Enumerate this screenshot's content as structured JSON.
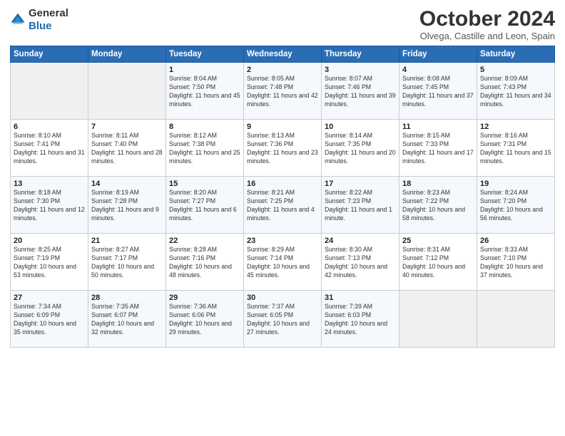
{
  "header": {
    "logo_general": "General",
    "logo_blue": "Blue",
    "title": "October 2024",
    "subtitle": "Olvega, Castille and Leon, Spain"
  },
  "weekdays": [
    "Sunday",
    "Monday",
    "Tuesday",
    "Wednesday",
    "Thursday",
    "Friday",
    "Saturday"
  ],
  "weeks": [
    [
      {
        "day": "",
        "detail": ""
      },
      {
        "day": "",
        "detail": ""
      },
      {
        "day": "1",
        "detail": "Sunrise: 8:04 AM\nSunset: 7:50 PM\nDaylight: 11 hours and 45 minutes."
      },
      {
        "day": "2",
        "detail": "Sunrise: 8:05 AM\nSunset: 7:48 PM\nDaylight: 11 hours and 42 minutes."
      },
      {
        "day": "3",
        "detail": "Sunrise: 8:07 AM\nSunset: 7:46 PM\nDaylight: 11 hours and 39 minutes."
      },
      {
        "day": "4",
        "detail": "Sunrise: 8:08 AM\nSunset: 7:45 PM\nDaylight: 11 hours and 37 minutes."
      },
      {
        "day": "5",
        "detail": "Sunrise: 8:09 AM\nSunset: 7:43 PM\nDaylight: 11 hours and 34 minutes."
      }
    ],
    [
      {
        "day": "6",
        "detail": "Sunrise: 8:10 AM\nSunset: 7:41 PM\nDaylight: 11 hours and 31 minutes."
      },
      {
        "day": "7",
        "detail": "Sunrise: 8:11 AM\nSunset: 7:40 PM\nDaylight: 11 hours and 28 minutes."
      },
      {
        "day": "8",
        "detail": "Sunrise: 8:12 AM\nSunset: 7:38 PM\nDaylight: 11 hours and 25 minutes."
      },
      {
        "day": "9",
        "detail": "Sunrise: 8:13 AM\nSunset: 7:36 PM\nDaylight: 11 hours and 23 minutes."
      },
      {
        "day": "10",
        "detail": "Sunrise: 8:14 AM\nSunset: 7:35 PM\nDaylight: 11 hours and 20 minutes."
      },
      {
        "day": "11",
        "detail": "Sunrise: 8:15 AM\nSunset: 7:33 PM\nDaylight: 11 hours and 17 minutes."
      },
      {
        "day": "12",
        "detail": "Sunrise: 8:16 AM\nSunset: 7:31 PM\nDaylight: 11 hours and 15 minutes."
      }
    ],
    [
      {
        "day": "13",
        "detail": "Sunrise: 8:18 AM\nSunset: 7:30 PM\nDaylight: 11 hours and 12 minutes."
      },
      {
        "day": "14",
        "detail": "Sunrise: 8:19 AM\nSunset: 7:28 PM\nDaylight: 11 hours and 9 minutes."
      },
      {
        "day": "15",
        "detail": "Sunrise: 8:20 AM\nSunset: 7:27 PM\nDaylight: 11 hours and 6 minutes."
      },
      {
        "day": "16",
        "detail": "Sunrise: 8:21 AM\nSunset: 7:25 PM\nDaylight: 11 hours and 4 minutes."
      },
      {
        "day": "17",
        "detail": "Sunrise: 8:22 AM\nSunset: 7:23 PM\nDaylight: 11 hours and 1 minute."
      },
      {
        "day": "18",
        "detail": "Sunrise: 8:23 AM\nSunset: 7:22 PM\nDaylight: 10 hours and 58 minutes."
      },
      {
        "day": "19",
        "detail": "Sunrise: 8:24 AM\nSunset: 7:20 PM\nDaylight: 10 hours and 56 minutes."
      }
    ],
    [
      {
        "day": "20",
        "detail": "Sunrise: 8:25 AM\nSunset: 7:19 PM\nDaylight: 10 hours and 53 minutes."
      },
      {
        "day": "21",
        "detail": "Sunrise: 8:27 AM\nSunset: 7:17 PM\nDaylight: 10 hours and 50 minutes."
      },
      {
        "day": "22",
        "detail": "Sunrise: 8:28 AM\nSunset: 7:16 PM\nDaylight: 10 hours and 48 minutes."
      },
      {
        "day": "23",
        "detail": "Sunrise: 8:29 AM\nSunset: 7:14 PM\nDaylight: 10 hours and 45 minutes."
      },
      {
        "day": "24",
        "detail": "Sunrise: 8:30 AM\nSunset: 7:13 PM\nDaylight: 10 hours and 42 minutes."
      },
      {
        "day": "25",
        "detail": "Sunrise: 8:31 AM\nSunset: 7:12 PM\nDaylight: 10 hours and 40 minutes."
      },
      {
        "day": "26",
        "detail": "Sunrise: 8:33 AM\nSunset: 7:10 PM\nDaylight: 10 hours and 37 minutes."
      }
    ],
    [
      {
        "day": "27",
        "detail": "Sunrise: 7:34 AM\nSunset: 6:09 PM\nDaylight: 10 hours and 35 minutes."
      },
      {
        "day": "28",
        "detail": "Sunrise: 7:35 AM\nSunset: 6:07 PM\nDaylight: 10 hours and 32 minutes."
      },
      {
        "day": "29",
        "detail": "Sunrise: 7:36 AM\nSunset: 6:06 PM\nDaylight: 10 hours and 29 minutes."
      },
      {
        "day": "30",
        "detail": "Sunrise: 7:37 AM\nSunset: 6:05 PM\nDaylight: 10 hours and 27 minutes."
      },
      {
        "day": "31",
        "detail": "Sunrise: 7:39 AM\nSunset: 6:03 PM\nDaylight: 10 hours and 24 minutes."
      },
      {
        "day": "",
        "detail": ""
      },
      {
        "day": "",
        "detail": ""
      }
    ]
  ]
}
